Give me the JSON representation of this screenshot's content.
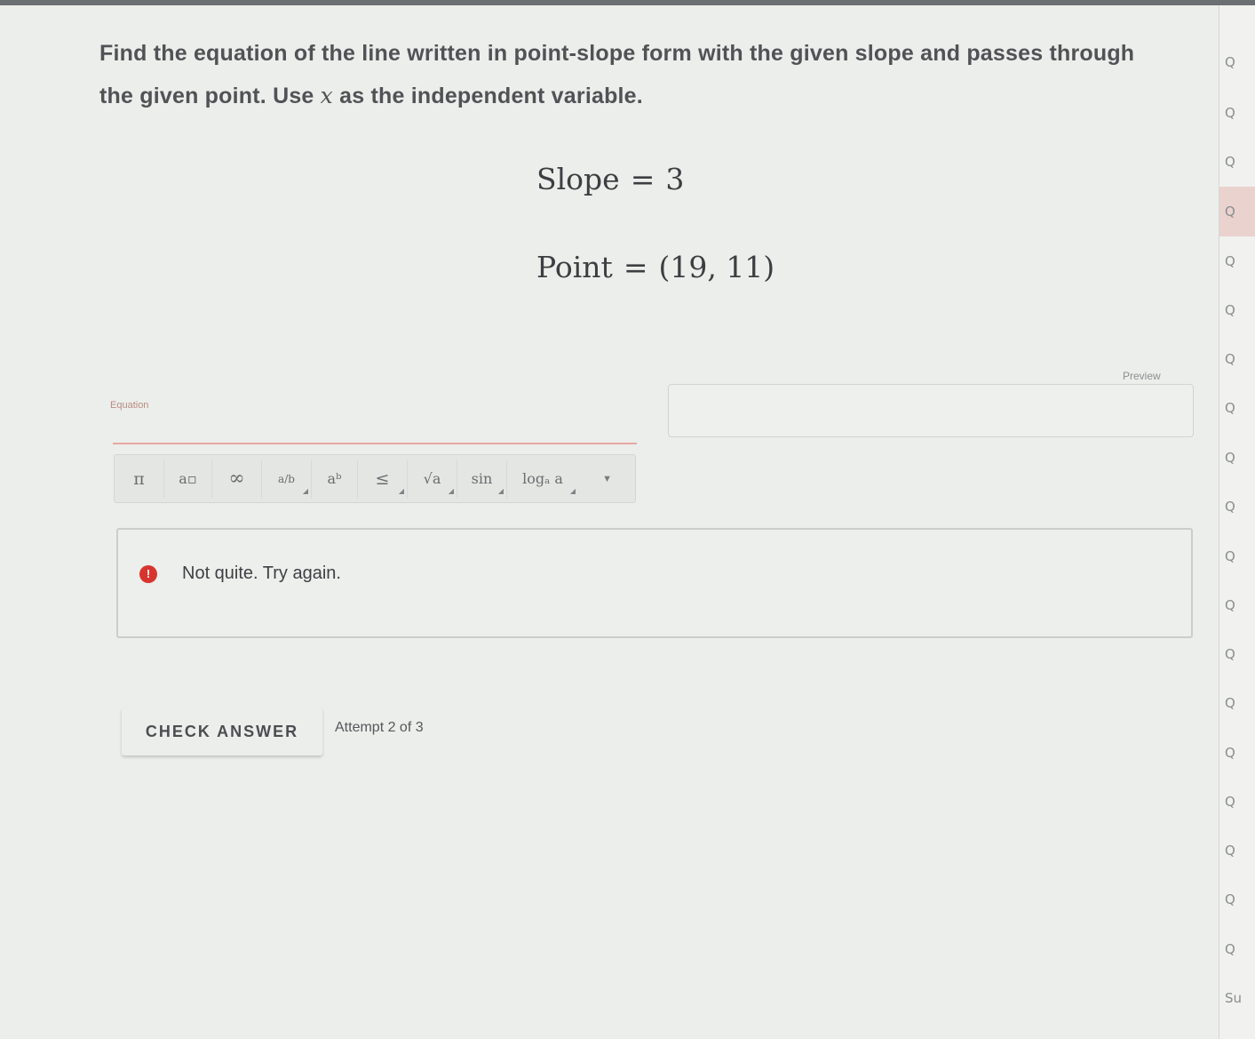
{
  "question": {
    "text_before": "Find the equation of the line written in point-slope form with the given slope and passes through the given point. Use ",
    "variable": "x",
    "text_after": " as the independent variable."
  },
  "given": {
    "slope_label": "Slope",
    "slope_value": "3",
    "point_label": "Point",
    "point_value": "(19, 11)",
    "equals": "="
  },
  "answer": {
    "label": "Equation",
    "preview_label": "Preview"
  },
  "toolbar": {
    "buttons": [
      {
        "symbol": "π",
        "icon": "pi-icon"
      },
      {
        "symbol": "a▫",
        "icon": "superscript-icon"
      },
      {
        "symbol": "∞",
        "icon": "infinity-icon"
      },
      {
        "symbol": "a/b",
        "icon": "fraction-icon"
      },
      {
        "symbol": "aᵇ",
        "icon": "power-icon"
      },
      {
        "symbol": "≤",
        "icon": "less-equal-icon"
      },
      {
        "symbol": "√a",
        "icon": "sqrt-icon"
      },
      {
        "symbol": "sin",
        "icon": "trig-icon"
      },
      {
        "symbol": "logₐ a",
        "icon": "log-icon"
      }
    ]
  },
  "feedback": {
    "icon": "!",
    "message": "Not quite. Try again."
  },
  "actions": {
    "check_label": "CHECK ANSWER",
    "attempt_text": "Attempt 2 of 3"
  },
  "sidebar": {
    "items": [
      "Q",
      "Q",
      "Q",
      "Q",
      "Q",
      "Q",
      "Q",
      "Q",
      "Q",
      "Q",
      "Q",
      "Q",
      "Q",
      "Q",
      "Q",
      "Q",
      "Q",
      "Q",
      "Q",
      "Su"
    ],
    "active_index": 3
  },
  "colors": {
    "error": "#d8342e",
    "active_question": "#ead2cf"
  }
}
